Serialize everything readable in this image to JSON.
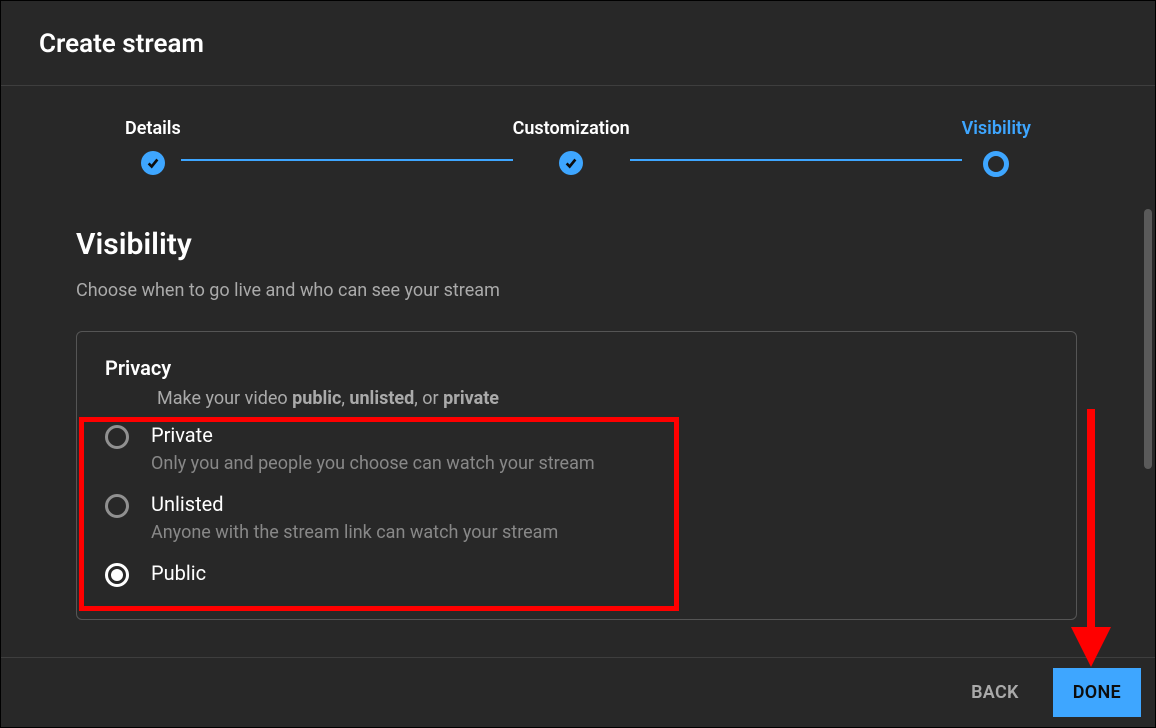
{
  "header": {
    "title": "Create stream"
  },
  "stepper": {
    "steps": [
      {
        "label": "Details",
        "state": "done"
      },
      {
        "label": "Customization",
        "state": "done"
      },
      {
        "label": "Visibility",
        "state": "active"
      }
    ]
  },
  "section": {
    "title": "Visibility",
    "subtitle": "Choose when to go live and who can see your stream"
  },
  "privacy": {
    "title": "Privacy",
    "subtitle_prefix": "Make your video ",
    "kw1": "public",
    "sep1": ", ",
    "kw2": "unlisted",
    "sep2": ", or ",
    "kw3": "private",
    "options": [
      {
        "label": "Private",
        "desc": "Only you and people you choose can watch your stream",
        "selected": false
      },
      {
        "label": "Unlisted",
        "desc": "Anyone with the stream link can watch your stream",
        "selected": false
      },
      {
        "label": "Public",
        "desc": "",
        "selected": true
      }
    ]
  },
  "footer": {
    "back": "BACK",
    "done": "DONE"
  },
  "colors": {
    "accent": "#3ea6ff",
    "highlight": "#ff0000"
  }
}
